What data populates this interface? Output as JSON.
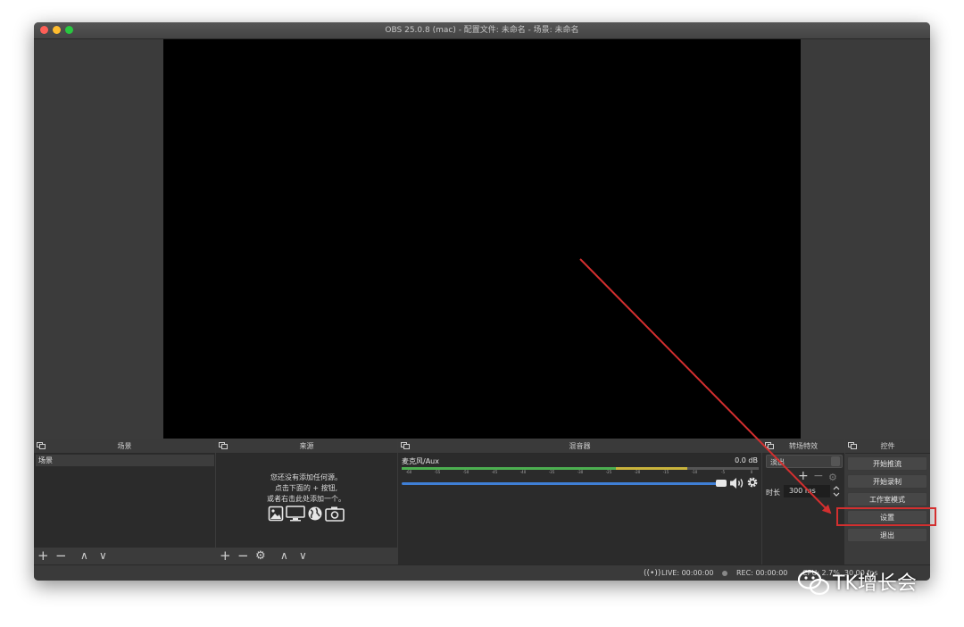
{
  "window": {
    "title": "OBS 25.0.8 (mac) - 配置文件: 未命名 - 场景: 未命名"
  },
  "scenes": {
    "title": "场景",
    "items": [
      "场景"
    ]
  },
  "sources": {
    "title": "来源",
    "empty_lines": [
      "您还没有添加任何源。",
      "点击下面的 + 按钮,",
      "或者右击此处添加一个。"
    ]
  },
  "mixer": {
    "title": "混音器",
    "channel_name": "麦克风/Aux",
    "level": "0.0 dB",
    "volume": 1.0,
    "scale": [
      "-60",
      "-55",
      "-50",
      "-45",
      "-40",
      "-35",
      "-30",
      "-25",
      "-20",
      "-15",
      "-10",
      "-5",
      "0"
    ]
  },
  "transitions": {
    "title": "转场特效",
    "selected": "淡出",
    "duration_label": "时长",
    "duration_value": "300 ms"
  },
  "controls": {
    "title": "控件",
    "buttons": [
      "开始推流",
      "开始录制",
      "工作室模式",
      "设置",
      "退出"
    ]
  },
  "status": {
    "live": "LIVE: 00:00:00",
    "rec": "REC: 00:00:00",
    "cpu": "CPU: 2.7%, 30.00 fps"
  },
  "watermark": {
    "text": "TK增长会"
  },
  "colors": {
    "annotation": "#d32f2f",
    "volume": "#3f7fd6",
    "meter_green": "#4caf50"
  }
}
